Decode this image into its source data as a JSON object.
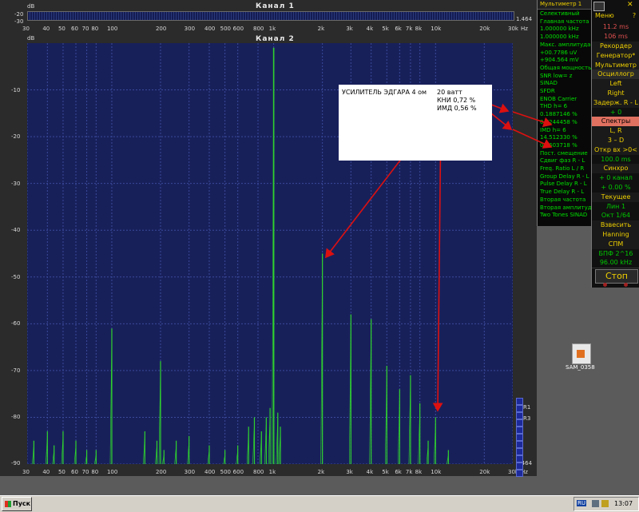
{
  "channel1": {
    "title": "Канал 1",
    "db_unit": "dB",
    "y_top": "-20",
    "y_bottom": "-30",
    "value": "1.464"
  },
  "channel2": {
    "title": "Канал 2",
    "db_unit": "dB",
    "value": "1.464"
  },
  "hz_unit": "Hz",
  "freq_ticks": [
    "30",
    "40",
    "50",
    "60",
    "70",
    "80",
    "100",
    "200",
    "300",
    "400",
    "500",
    "600",
    "800",
    "1k",
    "2k",
    "3k",
    "4k",
    "5k",
    "6k",
    "7k",
    "8k",
    "10k",
    "20k",
    "30k"
  ],
  "db_ticks": [
    "-10",
    "-20",
    "-30",
    "-40",
    "-50",
    "-60",
    "-70",
    "-80",
    "-90"
  ],
  "legend": [
    "R1",
    "R3"
  ],
  "note": {
    "title": "УСИЛИТЕЛЬ  ЭДГАРА   4 ом",
    "power": "20 ватт",
    "thd": "КНИ 0,72 %",
    "imd": "ИМД  0,56 %"
  },
  "multimeter": {
    "title": "Мультиметр 1",
    "rows": [
      {
        "text": "Селективный",
        "color": "#00e000"
      },
      {
        "text": "Главная частота",
        "color": "#00e000"
      },
      {
        "text": "1.000000 kHz",
        "color": "#00e000"
      },
      {
        "text": "1.000000 kHz",
        "color": "#00e000"
      },
      {
        "text": "Макс. амплитуда",
        "color": "#00e000"
      },
      {
        "text": "+00.7786 uV",
        "color": "#00e000"
      },
      {
        "text": "+904.564 mV",
        "color": "#00e000"
      },
      {
        "text": "Общая мощность",
        "color": "#00e000"
      },
      {
        "text": "SNR     low= z",
        "color": "#00e000"
      },
      {
        "text": "SINAD",
        "color": "#00e000"
      },
      {
        "text": "SFDR",
        "color": "#00e000"
      },
      {
        "text": "ENOB  Carrier",
        "color": "#00e000"
      },
      {
        "text": "THD     h=   6",
        "color": "#00e000"
      },
      {
        "text": "0.1887146 %",
        "color": "#00e000"
      },
      {
        "text": "0.7244458 %",
        "color": "#00e000"
      },
      {
        "text": "IMD     h=   6",
        "color": "#00e000"
      },
      {
        "text": "14.512330 %",
        "color": "#00e000"
      },
      {
        "text": "0.5603718 %",
        "color": "#00e000"
      },
      {
        "text": "Пост. смещение",
        "color": "#00e000"
      },
      {
        "text": "Сдвиг фаз R - L",
        "color": "#00e000"
      },
      {
        "text": "Freq. Ratio  L / R",
        "color": "#00e000"
      },
      {
        "text": "Group Delay R - L",
        "color": "#00e000"
      },
      {
        "text": "Pulse Delay R - L",
        "color": "#00e000"
      },
      {
        "text": "True Delay R - L",
        "color": "#00e000"
      },
      {
        "text": "Вторая частота",
        "color": "#00e000"
      },
      {
        "text": "Вторая амплитуда",
        "color": "#00e000"
      },
      {
        "text": "Two Tones SINAD",
        "color": "#00e000"
      }
    ]
  },
  "control": {
    "menu": "Меню",
    "menu_q": "?",
    "time1": "11.2 ms",
    "time2": "106 ms",
    "buttons": [
      {
        "label": "Рекордер",
        "color": "#f0d000",
        "bg": "#1a1a1a"
      },
      {
        "label": "Генератор*",
        "color": "#f0d000",
        "bg": "#1a1a1a"
      },
      {
        "label": "Мультиметр",
        "color": "#f0d000",
        "bg": "#1a1a1a"
      },
      {
        "label": "Осциллогр",
        "color": "#f0d000",
        "bg": "#2a2a2a"
      },
      {
        "label": "Left",
        "color": "#f0d000",
        "bg": "#1a1a1a"
      },
      {
        "label": "Right",
        "color": "#f0d000",
        "bg": "#1a1a1a"
      },
      {
        "label": "Задерж. R - L",
        "color": "#f0d000",
        "bg": "#1a1a1a"
      },
      {
        "label": "+   0",
        "color": "#00c800",
        "bg": "#101010"
      },
      {
        "label": "Спектры",
        "color": "#000000",
        "bg": "#e07060"
      },
      {
        "label": "L, R",
        "color": "#f0d000",
        "bg": "#1a1a1a"
      },
      {
        "label": "3 – D",
        "color": "#f0d000",
        "bg": "#1a1a1a"
      },
      {
        "label": "Откр вх >0<",
        "color": "#f0d000",
        "bg": "#1a1a1a"
      },
      {
        "label": "100.0 ms",
        "color": "#00c800",
        "bg": "#101010"
      },
      {
        "label": "Синхро",
        "color": "#f0d000",
        "bg": "#1a1a1a"
      },
      {
        "label": "+  0 канал",
        "color": "#00c800",
        "bg": "#101010"
      },
      {
        "label": "+  0.00 %",
        "color": "#00c800",
        "bg": "#101010"
      },
      {
        "label": "Текущее",
        "color": "#f0d000",
        "bg": "#1a1a1a"
      },
      {
        "label": "Лин        1",
        "color": "#00c800",
        "bg": "#101010"
      },
      {
        "label": "Окт    1/64",
        "color": "#00c800",
        "bg": "#101010"
      },
      {
        "label": "Взвесить",
        "color": "#f0d000",
        "bg": "#1a1a1a"
      },
      {
        "label": "Hanning",
        "color": "#f0d000",
        "bg": "#1a1a1a"
      },
      {
        "label": "СПМ",
        "color": "#f0d000",
        "bg": "#1a1a1a"
      },
      {
        "label": "БПФ  2^16",
        "color": "#00c800",
        "bg": "#101010"
      },
      {
        "label": "96.00 kHz",
        "color": "#00c800",
        "bg": "#101010"
      }
    ],
    "stop": "Стоп"
  },
  "desktop_icon": {
    "label": "SAM_0358"
  },
  "taskbar": {
    "start": "Пуск",
    "lang": "RU",
    "clock": "13:07"
  },
  "colors": {
    "plot_bg": "#18205a",
    "grid": "#3a4a9a",
    "spectrum": "#2fd22f",
    "arrow": "#dd1010"
  },
  "chart_data": {
    "type": "line",
    "x_scale": "log",
    "xlim": [
      30,
      30000
    ],
    "ylim": [
      -90,
      0
    ],
    "xlabel": "Hz",
    "ylabel": "dB",
    "title": "Канал 2",
    "peaks": [
      {
        "f": 33,
        "db": -85
      },
      {
        "f": 40,
        "db": -83
      },
      {
        "f": 44,
        "db": -86
      },
      {
        "f": 50,
        "db": -83
      },
      {
        "f": 60,
        "db": -85
      },
      {
        "f": 70,
        "db": -87
      },
      {
        "f": 80,
        "db": -87
      },
      {
        "f": 100,
        "db": -61
      },
      {
        "f": 160,
        "db": -83
      },
      {
        "f": 190,
        "db": -85
      },
      {
        "f": 200,
        "db": -68
      },
      {
        "f": 210,
        "db": -87
      },
      {
        "f": 250,
        "db": -85
      },
      {
        "f": 300,
        "db": -84
      },
      {
        "f": 400,
        "db": -86
      },
      {
        "f": 500,
        "db": -87
      },
      {
        "f": 600,
        "db": -86
      },
      {
        "f": 700,
        "db": -82
      },
      {
        "f": 760,
        "db": -80
      },
      {
        "f": 840,
        "db": -83
      },
      {
        "f": 900,
        "db": -80
      },
      {
        "f": 950,
        "db": -78
      },
      {
        "f": 1000,
        "db": -1
      },
      {
        "f": 1060,
        "db": -79
      },
      {
        "f": 1100,
        "db": -82
      },
      {
        "f": 2000,
        "db": -45
      },
      {
        "f": 3000,
        "db": -58
      },
      {
        "f": 4000,
        "db": -59
      },
      {
        "f": 5000,
        "db": -69
      },
      {
        "f": 6000,
        "db": -74
      },
      {
        "f": 7000,
        "db": -71
      },
      {
        "f": 8000,
        "db": -77
      },
      {
        "f": 9000,
        "db": -85
      },
      {
        "f": 10000,
        "db": -80
      },
      {
        "f": 12000,
        "db": -87
      }
    ]
  }
}
